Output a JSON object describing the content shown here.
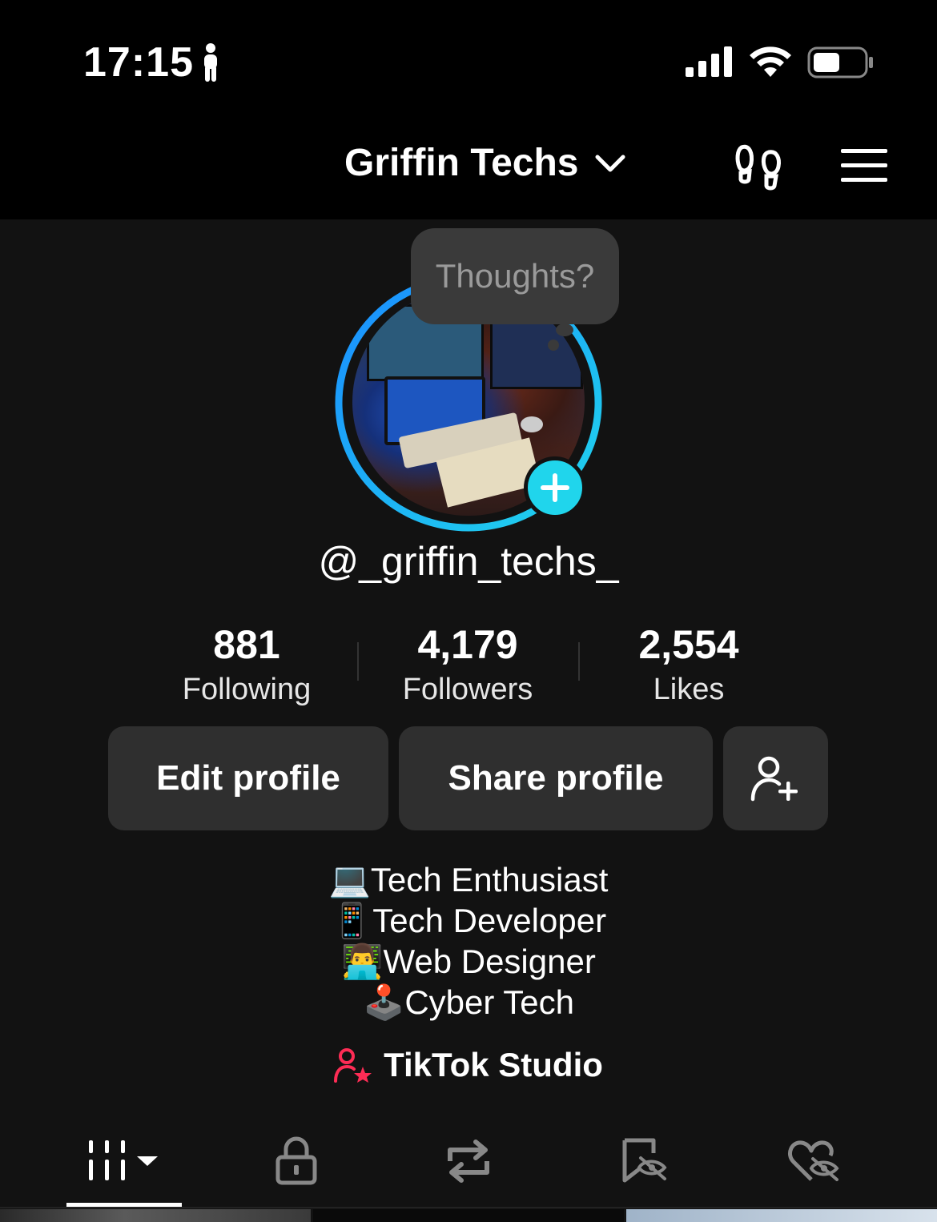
{
  "status_bar": {
    "time": "17:15"
  },
  "header": {
    "title": "Griffin Techs"
  },
  "profile": {
    "note_prompt": "Thoughts?",
    "username": "@_griffin_techs_"
  },
  "stats": [
    {
      "value": "881",
      "label": "Following"
    },
    {
      "value": "4,179",
      "label": "Followers"
    },
    {
      "value": "2,554",
      "label": "Likes"
    }
  ],
  "actions": {
    "edit_label": "Edit profile",
    "share_label": "Share profile"
  },
  "bio": [
    {
      "emoji": "💻",
      "text": "Tech Enthusiast"
    },
    {
      "emoji": "📱",
      "text": "Tech Developer"
    },
    {
      "emoji": "👨‍💻",
      "text": "Web Designer"
    },
    {
      "emoji": "🕹️",
      "text": "Cyber Tech"
    }
  ],
  "studio_link": {
    "label": "TikTok Studio"
  },
  "tabs": [
    {
      "icon": "videos-grid-icon",
      "active": true
    },
    {
      "icon": "lock-icon",
      "active": false
    },
    {
      "icon": "repost-icon",
      "active": false
    },
    {
      "icon": "saved-hidden-icon",
      "active": false
    },
    {
      "icon": "liked-hidden-icon",
      "active": false
    }
  ],
  "colors": {
    "accent": "#20d5ec",
    "studio_icon": "#fe2c55",
    "background": "#121212"
  }
}
